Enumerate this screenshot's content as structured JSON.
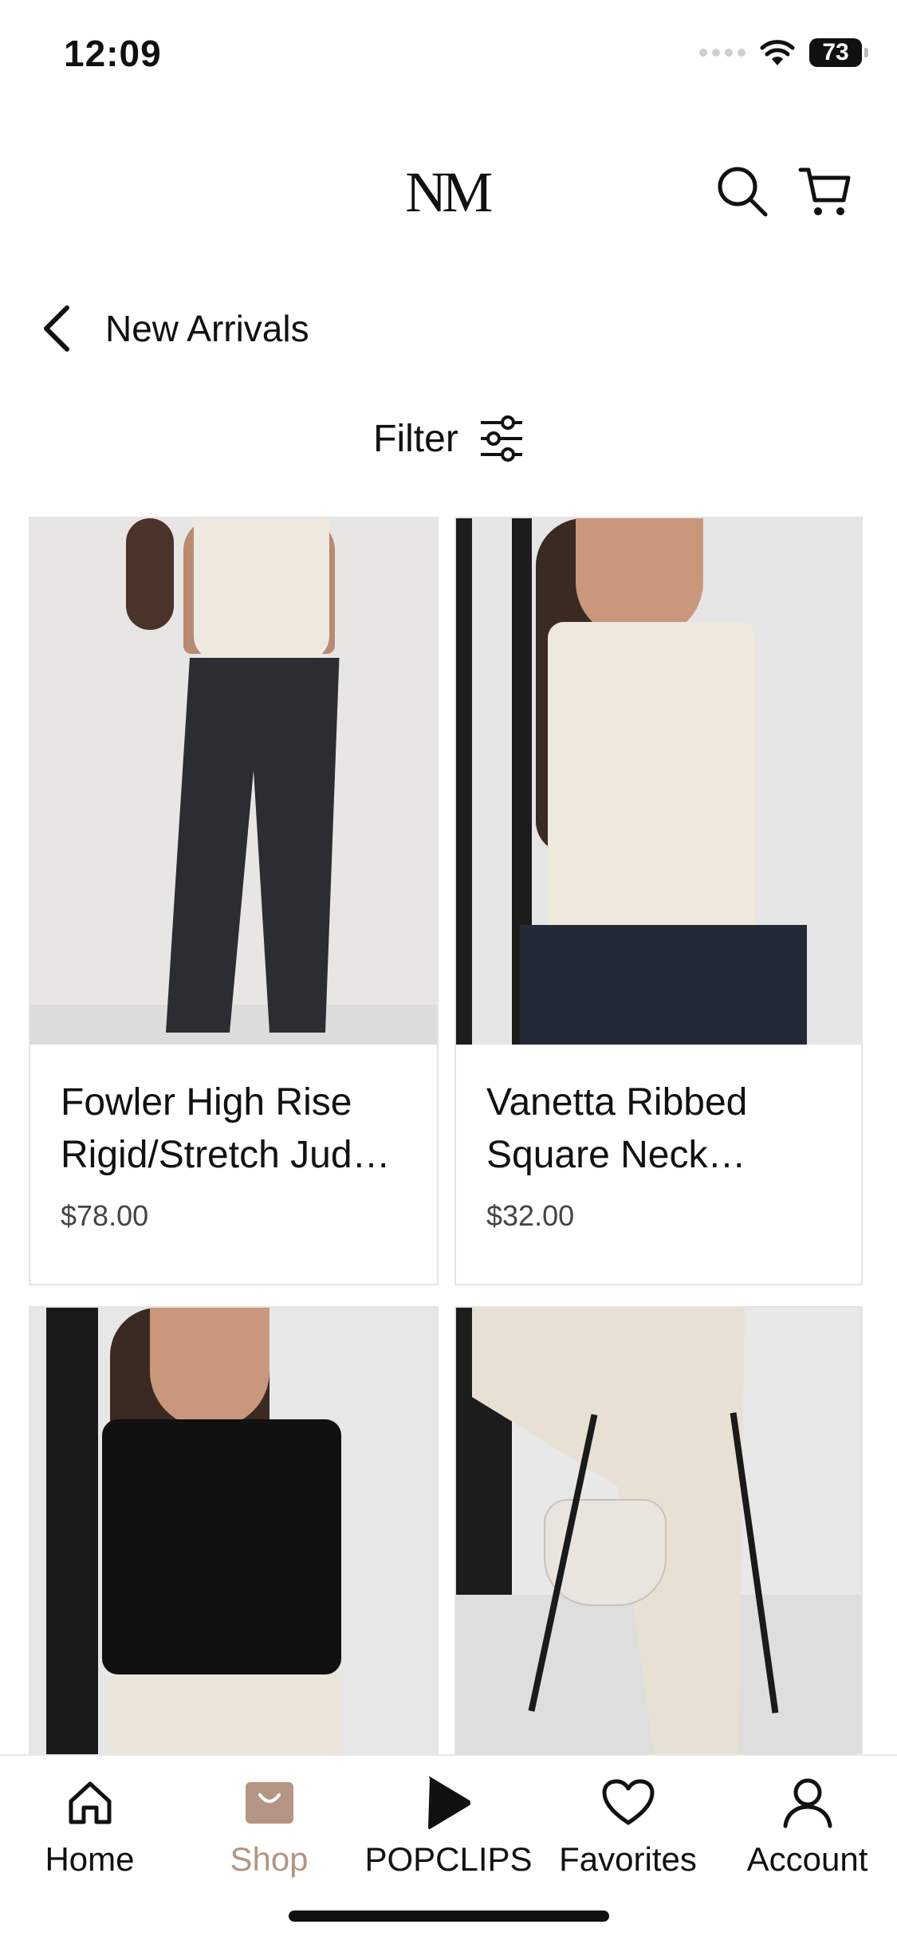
{
  "status_bar": {
    "time": "12:09",
    "battery": "73"
  },
  "header": {
    "logo": "NM",
    "logo_mark": "."
  },
  "page": {
    "title": "New Arrivals",
    "back_icon": "chevron-left-icon"
  },
  "filter": {
    "label": "Filter",
    "icon": "sliders-icon"
  },
  "products": [
    {
      "name": "Fowler High Rise Rigid/Stretch Judy Blue Jeans",
      "price": "$78.00"
    },
    {
      "name": "Vanetta Ribbed Square Neck Washed Tank",
      "price": "$32.00"
    },
    {
      "name": "",
      "price": ""
    },
    {
      "name": "",
      "price": ""
    }
  ],
  "tabbar": {
    "items": [
      {
        "label": "Home",
        "icon": "home-icon"
      },
      {
        "label": "Shop",
        "icon": "shopping-bag-icon",
        "active": true
      },
      {
        "label": "POPCLIPS",
        "icon": "play-icon"
      },
      {
        "label": "Favorites",
        "icon": "heart-icon"
      },
      {
        "label": "Account",
        "icon": "person-icon"
      }
    ]
  },
  "colors": {
    "accent": "#b49583",
    "text": "#111111",
    "border": "#e4e4e4"
  }
}
